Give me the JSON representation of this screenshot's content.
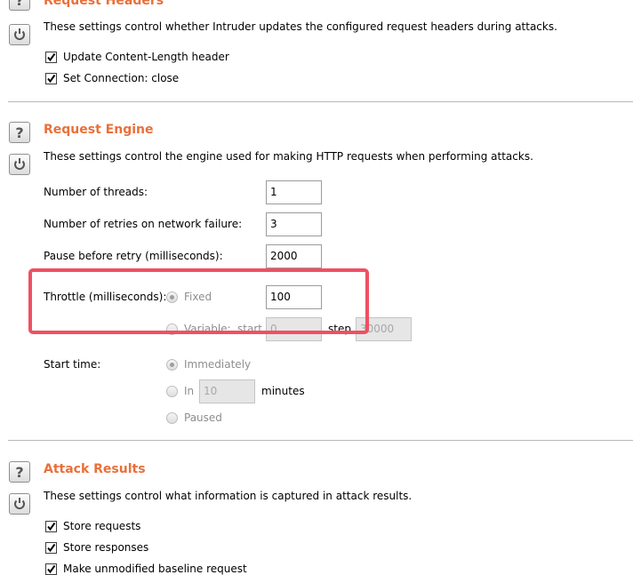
{
  "request_headers": {
    "title": "Request Headers",
    "description": "These settings control whether Intruder updates the configured request headers during attacks.",
    "options": [
      {
        "label": "Update Content-Length header",
        "checked": true
      },
      {
        "label": "Set Connection: close",
        "checked": true
      }
    ]
  },
  "request_engine": {
    "title": "Request Engine",
    "description": "These settings control the engine used for making HTTP requests when performing attacks.",
    "threads_label": "Number of threads:",
    "threads_value": "1",
    "retries_label": "Number of retries on network failure:",
    "retries_value": "3",
    "pause_label": "Pause before retry (milliseconds):",
    "pause_value": "2000",
    "throttle": {
      "label": "Throttle (milliseconds):",
      "fixed_label": "Fixed",
      "fixed_value": "100",
      "variable_label": "Variable:",
      "start_label": "start",
      "start_value": "0",
      "step_label": "step",
      "step_value": "30000",
      "selected": "Fixed"
    },
    "start_time": {
      "label": "Start time:",
      "immediately_label": "Immediately",
      "in_label": "In",
      "in_value": "10",
      "minutes_label": "minutes",
      "paused_label": "Paused",
      "selected": "Immediately"
    }
  },
  "attack_results": {
    "title": "Attack Results",
    "description": "These settings control what information is captured in attack results.",
    "options": [
      {
        "label": "Store requests",
        "checked": true
      },
      {
        "label": "Store responses",
        "checked": true
      },
      {
        "label": "Make unmodified baseline request",
        "checked": true
      }
    ]
  },
  "icons": {
    "help": "help-icon",
    "restore": "restore-defaults-icon",
    "checkmark": "checkmark-icon"
  },
  "colors": {
    "section_title": "#e8703a",
    "highlight_box": "#ef5063"
  }
}
